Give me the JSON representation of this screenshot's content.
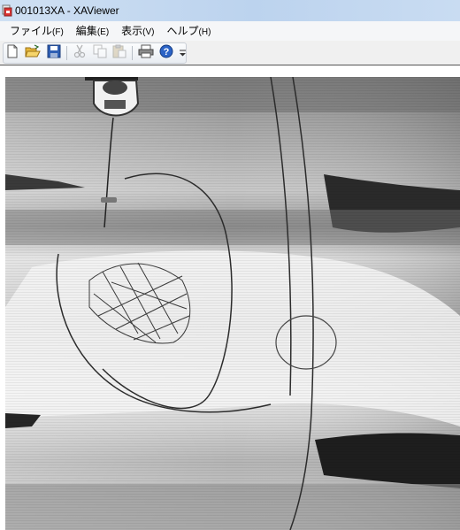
{
  "window": {
    "title": "001013XA - XAViewer"
  },
  "menu": {
    "items": [
      {
        "label": "ファイル",
        "accel": "(F)"
      },
      {
        "label": "編集",
        "accel": "(E)"
      },
      {
        "label": "表示",
        "accel": "(V)"
      },
      {
        "label": "ヘルプ",
        "accel": "(H)"
      }
    ]
  },
  "toolbar": {
    "buttons": [
      "new-document-icon",
      "open-folder-icon",
      "save-icon",
      "cut-icon",
      "copy-icon",
      "paste-icon",
      "print-icon",
      "help-icon"
    ],
    "disabled": [
      "cut-icon",
      "copy-icon",
      "paste-icon"
    ]
  },
  "viewer": {
    "content": "angiography-xray-frame"
  }
}
